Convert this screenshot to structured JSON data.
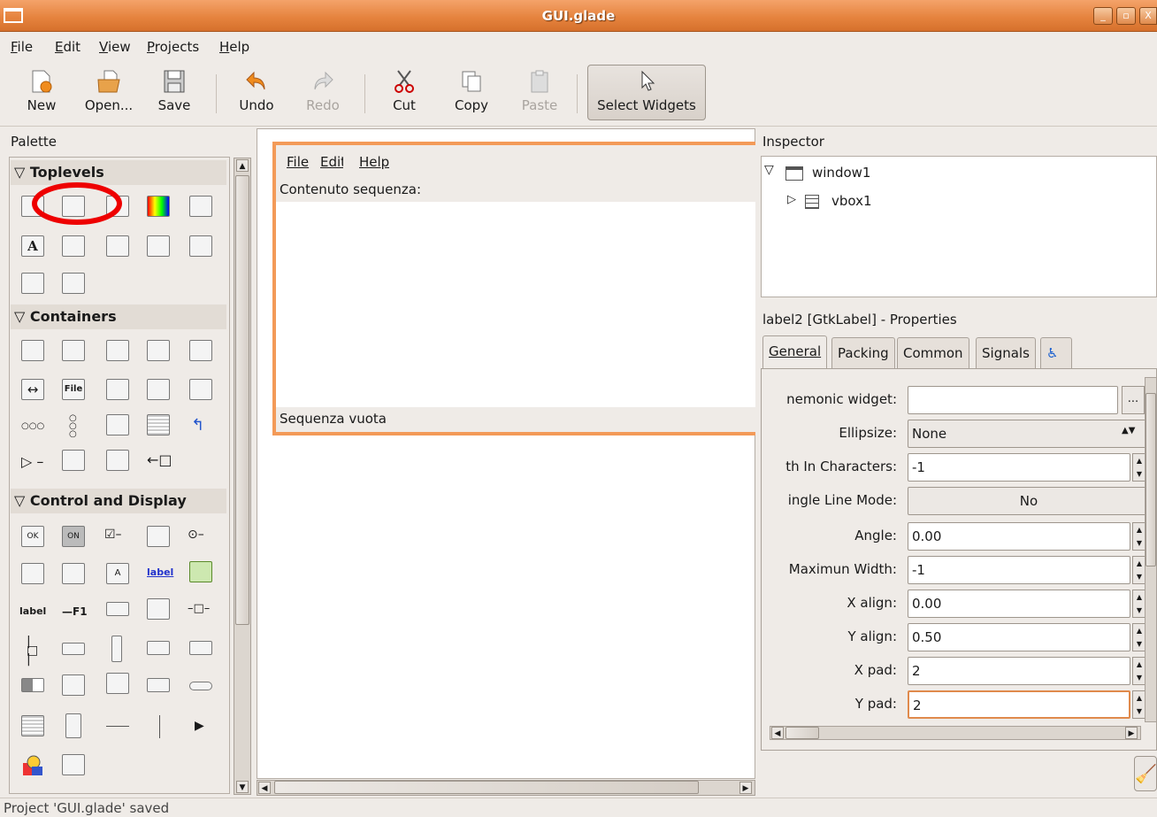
{
  "window": {
    "title": "GUI.glade",
    "min": "_",
    "max": "▫",
    "close": "X"
  },
  "menu": [
    "File",
    "Edit",
    "View",
    "Projects",
    "Help"
  ],
  "toolbar": {
    "new": "New",
    "open": "Open...",
    "save": "Save",
    "undo": "Undo",
    "redo": "Redo",
    "cut": "Cut",
    "copy": "Copy",
    "paste": "Paste",
    "select": "Select Widgets"
  },
  "palette": {
    "title": "Palette",
    "sections": {
      "toplevels": "Toplevels",
      "containers": "Containers",
      "control": "Control and Display"
    },
    "glyphs": {
      "file": "File",
      "label": "label",
      "f1": "—F1",
      "ok": "OK",
      "on": "ON",
      "a": "A"
    }
  },
  "canvas": {
    "menu": [
      "File",
      "Edit",
      "Help"
    ],
    "content_label": "Contenuto sequenza:",
    "status_label": "Sequenza vuota"
  },
  "inspector": {
    "title": "Inspector",
    "tree": [
      {
        "label": "window1"
      },
      {
        "label": "vbox1"
      }
    ]
  },
  "properties": {
    "title": "label2 [GtkLabel] - Properties",
    "tabs": [
      "General",
      "Packing",
      "Common",
      "Signals"
    ],
    "rows": [
      {
        "label": "nemonic widget:",
        "value": "",
        "button": "..."
      },
      {
        "label": "Ellipsize:",
        "value": "None"
      },
      {
        "label": "th In Characters:",
        "value": "-1"
      },
      {
        "label": "ingle Line Mode:",
        "value": "No"
      },
      {
        "label": "Angle:",
        "value": "0.00"
      },
      {
        "label": "Maximun Width:",
        "value": "-1"
      },
      {
        "label": "X align:",
        "value": "0.00"
      },
      {
        "label": "Y align:",
        "value": "0.50"
      },
      {
        "label": "X pad:",
        "value": "2"
      },
      {
        "label": "Y pad:",
        "value": "2"
      }
    ]
  },
  "status": "Project 'GUI.glade' saved"
}
